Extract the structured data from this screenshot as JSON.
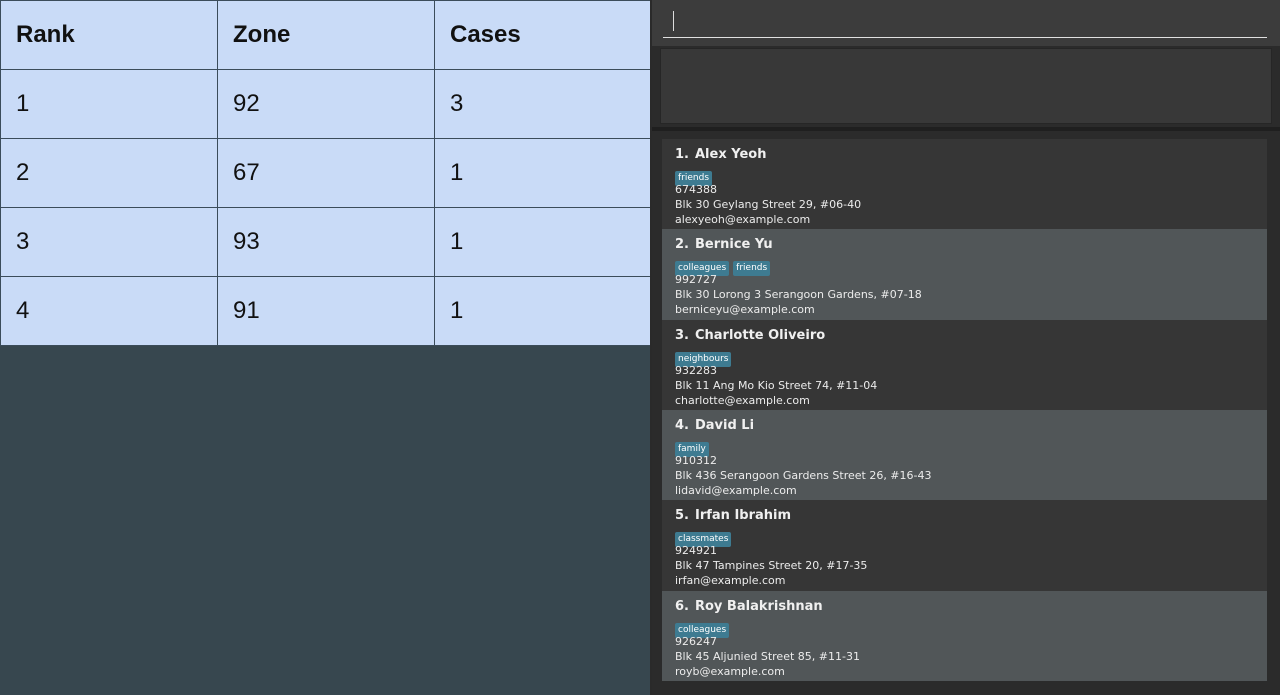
{
  "ranking_table": {
    "headers": [
      "Rank",
      "Zone",
      "Cases"
    ],
    "rows": [
      [
        "1",
        "92",
        "3"
      ],
      [
        "2",
        "67",
        "1"
      ],
      [
        "3",
        "93",
        "1"
      ],
      [
        "4",
        "91",
        "1"
      ]
    ]
  },
  "command_box": {
    "value": "",
    "placeholder": ""
  },
  "result_display": {
    "text": ""
  },
  "persons": [
    {
      "index": "1.",
      "name": "Alex Yeoh",
      "tags": [
        "friends"
      ],
      "phone": "674388",
      "address": "Blk 30 Geylang Street 29, #06-40",
      "email": "alexyeoh@example.com"
    },
    {
      "index": "2.",
      "name": "Bernice Yu",
      "tags": [
        "colleagues",
        "friends"
      ],
      "phone": "992727",
      "address": "Blk 30 Lorong 3 Serangoon Gardens, #07-18",
      "email": "berniceyu@example.com"
    },
    {
      "index": "3.",
      "name": "Charlotte Oliveiro",
      "tags": [
        "neighbours"
      ],
      "phone": "932283",
      "address": "Blk 11 Ang Mo Kio Street 74, #11-04",
      "email": "charlotte@example.com"
    },
    {
      "index": "4.",
      "name": "David Li",
      "tags": [
        "family"
      ],
      "phone": "910312",
      "address": "Blk 436 Serangoon Gardens Street 26, #16-43",
      "email": "lidavid@example.com"
    },
    {
      "index": "5.",
      "name": "Irfan Ibrahim",
      "tags": [
        "classmates"
      ],
      "phone": "924921",
      "address": "Blk 47 Tampines Street 20, #17-35",
      "email": "irfan@example.com"
    },
    {
      "index": "6.",
      "name": "Roy Balakrishnan",
      "tags": [
        "colleagues"
      ],
      "phone": "926247",
      "address": "Blk 45 Aljunied Street 85, #11-31",
      "email": "royb@example.com"
    }
  ],
  "colors": {
    "table_cell_bg": "#c9dbf7",
    "table_border": "#3b4c5a",
    "left_bg": "#37474f",
    "card_odd": "#363636",
    "card_even": "#515658",
    "tag_bg": "#3e7b91"
  }
}
